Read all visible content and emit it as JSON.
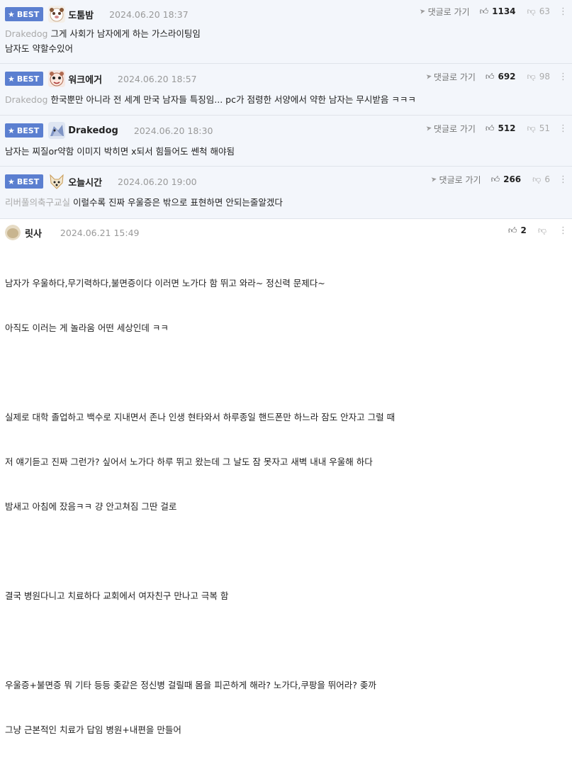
{
  "best_label": "BEST",
  "reply_label": "댓글로 가기",
  "comments": [
    {
      "nick": "도툼밤",
      "date": "2024.06.20 18:37",
      "likes": "1134",
      "dislikes": "63",
      "mention": "Drakedog",
      "text": "그게 사회가 남자에게 하는 가스라이팅임",
      "text2": "남자도 약할수있어"
    },
    {
      "nick": "워크에거",
      "date": "2024.06.20 18:57",
      "likes": "692",
      "dislikes": "98",
      "mention": "Drakedog",
      "text": "한국뿐만 아니라 전 세계 만국 남자들 특징임... pc가 점령한 서양에서 약한 남자는 무시받음 ㅋㅋㅋ"
    },
    {
      "nick": "Drakedog",
      "date": "2024.06.20 18:30",
      "likes": "512",
      "dislikes": "51",
      "text": "남자는 찌질or약함 이미지 박히면 x되서 힘들어도 쎈척 해야됨"
    },
    {
      "nick": "오늘시간",
      "date": "2024.06.20 19:00",
      "likes": "266",
      "dislikes": "6",
      "mention": "리버풀의축구교실",
      "text": "이럴수록 진짜 우울증은 밖으로 표현하면 안되는줄알겠다"
    },
    {
      "nick": "릿사",
      "date": "2024.06.21 15:49",
      "likes": "2",
      "lines": [
        "남자가 우울하다,무기력하다,불면증이다 이러면 노가다 함 뛰고 와라~ 정신력 문제다~",
        "아직도 이러는 게 놀라움 어떤 세상인데 ㅋㅋ",
        "",
        "실제로 대학 졸업하고 백수로 지내면서 존나 인생 현타와서 하루종일 핸드폰만 하느라 잠도 안자고 그럴 때",
        "저 얘기듣고 진짜 그런가? 싶어서 노가다 하루 뛰고 왔는데 그 날도 잠 못자고 새벽 내내 우울해 하다",
        "밤새고 아침에 잤음ㅋㅋ 걍 안고쳐짐 그딴 걸로",
        "",
        "결국 병원다니고 치료하다 교회에서 여자친구 만나고 극복 함",
        "",
        "우울증+불면증 뭐 기타 등등 좆같은 정신병 걸릴때 몸을 피곤하게 해라? 노가다,쿠팡을 뛰어라? 좆까",
        "그냥 근본적인 치료가 답임 병원+내편을 만들어"
      ]
    }
  ]
}
